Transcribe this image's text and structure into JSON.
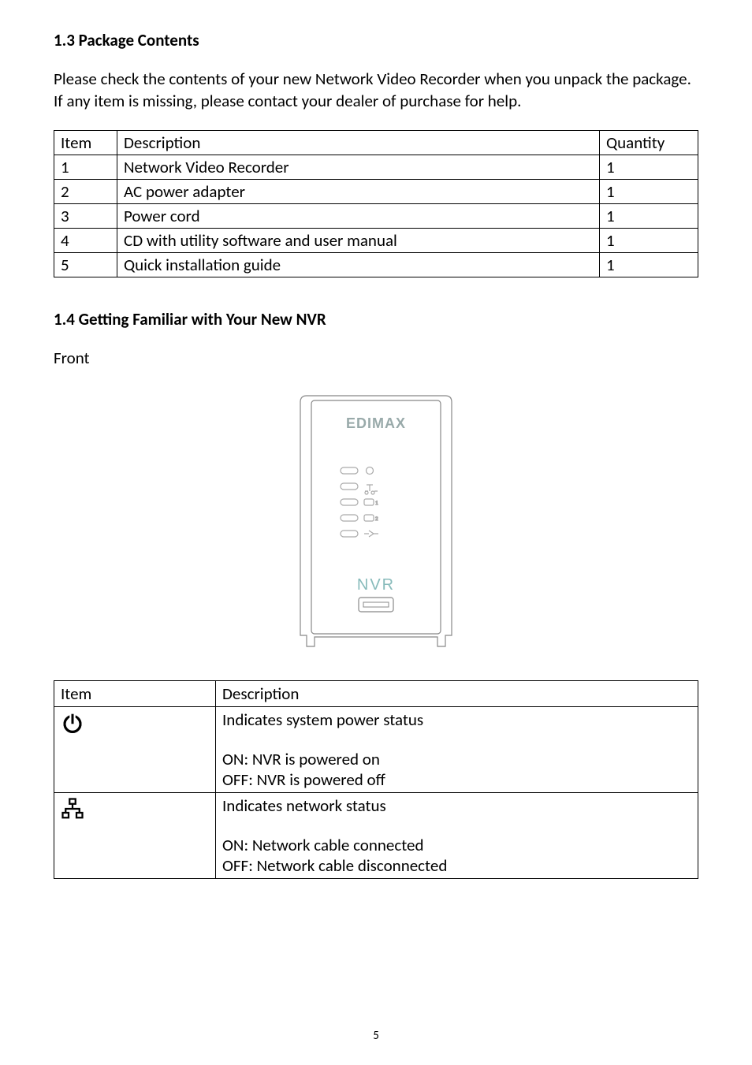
{
  "sections": {
    "pkg_title": "1.3 Package Contents",
    "pkg_intro": "Please check the contents of your new Network Video Recorder when you unpack the package. If any item is missing, please contact your dealer of purchase for help.",
    "fam_title": "1.4 Getting Familiar with Your New NVR",
    "front_label": "Front"
  },
  "pkg_table": {
    "headers": {
      "item": "Item",
      "desc": "Description",
      "qty": "Quantity"
    },
    "rows": [
      {
        "item": "1",
        "desc": "Network Video Recorder",
        "qty": "1"
      },
      {
        "item": "2",
        "desc": "AC power adapter",
        "qty": "1"
      },
      {
        "item": "3",
        "desc": "Power cord",
        "qty": "1"
      },
      {
        "item": "4",
        "desc": "CD with utility software and user manual",
        "qty": "1"
      },
      {
        "item": "5",
        "desc": "Quick installation guide",
        "qty": "1"
      }
    ]
  },
  "device_figure": {
    "brand": "EDIMAX",
    "label": "NVR"
  },
  "desc_table": {
    "headers": {
      "item": "Item",
      "desc": "Description"
    },
    "rows": [
      {
        "icon": "power",
        "line1": "Indicates system power status",
        "line_on": "ON: NVR is powered on",
        "line_off": "OFF: NVR is powered off"
      },
      {
        "icon": "network",
        "line1": "Indicates network status",
        "line_on": "ON: Network cable connected",
        "line_off": "OFF: Network cable disconnected"
      }
    ]
  },
  "page_number": "5"
}
